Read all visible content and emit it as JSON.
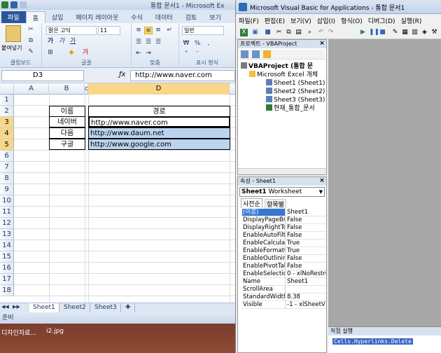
{
  "excel": {
    "title": "통합 문서1 - Microsoft Ex",
    "tabs": [
      "파일",
      "홈",
      "삽입",
      "페이지 레이아웃",
      "수식",
      "데이터",
      "검토",
      "보기"
    ],
    "ribbon": {
      "paste_label": "붙여넣기",
      "font_name": "맑은 고딕",
      "font_size": "11",
      "number_format": "일반",
      "groups": [
        "클립보드",
        "글꼴",
        "맞춤",
        "표시 형식"
      ]
    },
    "name_box": "D3",
    "formula": "http://www.naver.com",
    "columns": [
      "A",
      "B",
      "C",
      "D"
    ],
    "rows": [
      "1",
      "2",
      "3",
      "4",
      "5",
      "6",
      "7",
      "8",
      "9",
      "10",
      "11",
      "12",
      "13",
      "14",
      "15",
      "16",
      "17",
      "18"
    ],
    "table": {
      "header_name": "이름",
      "header_path": "경로",
      "rows": [
        {
          "name": "네이버",
          "url": "http://www.naver.com"
        },
        {
          "name": "다음",
          "url": "http://www.daum.net"
        },
        {
          "name": "구글",
          "url": "http://www.google.com"
        }
      ]
    },
    "sheets": [
      "Sheet1",
      "Sheet2",
      "Sheet3"
    ],
    "status": "준비"
  },
  "taskbar": {
    "items": [
      "디자인자료...",
      "i2.jpg"
    ]
  },
  "vba": {
    "title": "Microsoft Visual Basic for Applications - 통합 문서1",
    "menu": [
      "파일(F)",
      "편집(E)",
      "보기(V)",
      "삽입(I)",
      "형식(O)",
      "디버그(D)",
      "실행(R)"
    ],
    "project": {
      "title": "프로젝트 - VBAProject",
      "root": "VBAProject (통합 문",
      "folder": "Microsoft Excel 개체",
      "items": [
        "Sheet1 (Sheet1)",
        "Sheet2 (Sheet2)",
        "Sheet3 (Sheet3)",
        "현재_통합_문서"
      ]
    },
    "properties": {
      "title": "속성 - Sheet1",
      "object_name": "Sheet1",
      "object_type": "Worksheet",
      "tabs": [
        "사전순",
        "항목별"
      ],
      "rows": [
        {
          "name": "(이름)",
          "value": "Sheet1"
        },
        {
          "name": "DisplayPageBr",
          "value": "False"
        },
        {
          "name": "DisplayRightTo",
          "value": "False"
        },
        {
          "name": "EnableAutoFilte",
          "value": "False"
        },
        {
          "name": "EnableCalculat",
          "value": "True"
        },
        {
          "name": "EnableFormatC",
          "value": "True"
        },
        {
          "name": "EnableOutlining",
          "value": "False"
        },
        {
          "name": "EnablePivotTab",
          "value": "False"
        },
        {
          "name": "EnableSelectio",
          "value": "0 - xlNoRestri"
        },
        {
          "name": "Name",
          "value": "Sheet1"
        },
        {
          "name": "ScrollArea",
          "value": ""
        },
        {
          "name": "StandardWidth",
          "value": "8.38"
        },
        {
          "name": "Visible",
          "value": "-1 - xlSheetV"
        }
      ]
    },
    "immediate": {
      "title": "직접 실행",
      "code": "Cells.Hyperlinks.Delete"
    }
  }
}
